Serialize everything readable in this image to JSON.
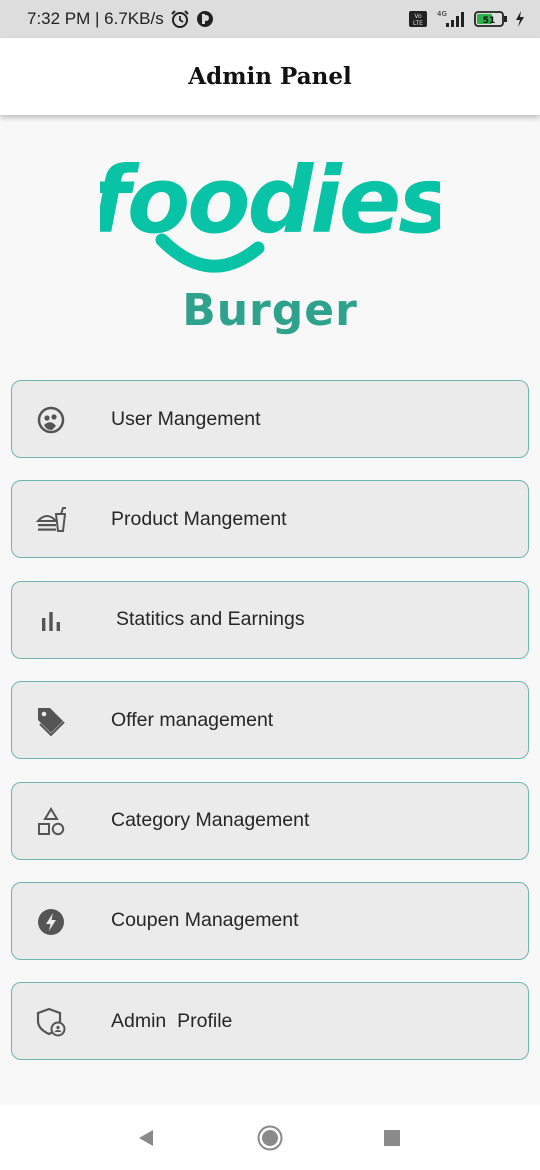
{
  "status_bar": {
    "text": "7:32 PM | 6.7KB/s",
    "icons": [
      "alarm-icon",
      "app-notification-icon"
    ],
    "right_icons": [
      "volte-icon",
      "4g-signal-icon",
      "battery-icon",
      "charging-icon"
    ],
    "network": "4G",
    "battery": "51"
  },
  "app_bar": {
    "title": "Admin Panel"
  },
  "logo": {
    "brand": "foodies",
    "subtitle": "Burger",
    "colors": {
      "brand": "#08c3a5",
      "subtitle": "#2fa28d"
    }
  },
  "menu": [
    {
      "label": "User Mangement",
      "icon": "face-icon"
    },
    {
      "label": "Product Mangement",
      "icon": "fastfood-icon"
    },
    {
      "label": "Statitics and Earnings",
      "icon": "bar-chart-icon"
    },
    {
      "label": "Offer management",
      "icon": "tag-icon"
    },
    {
      "label": "Category Management",
      "icon": "category-shapes-icon"
    },
    {
      "label": "Coupen Management",
      "icon": "flash-icon"
    },
    {
      "label": "Admin  Profile",
      "icon": "admin-shield-icon"
    }
  ],
  "nav_bar": {
    "buttons": [
      "back-icon",
      "home-icon",
      "recents-icon"
    ]
  },
  "colors": {
    "accent": "#08c3a5",
    "card_border": "#6fb5ae",
    "card_bg": "#ebebeb",
    "icon": "#555555"
  }
}
